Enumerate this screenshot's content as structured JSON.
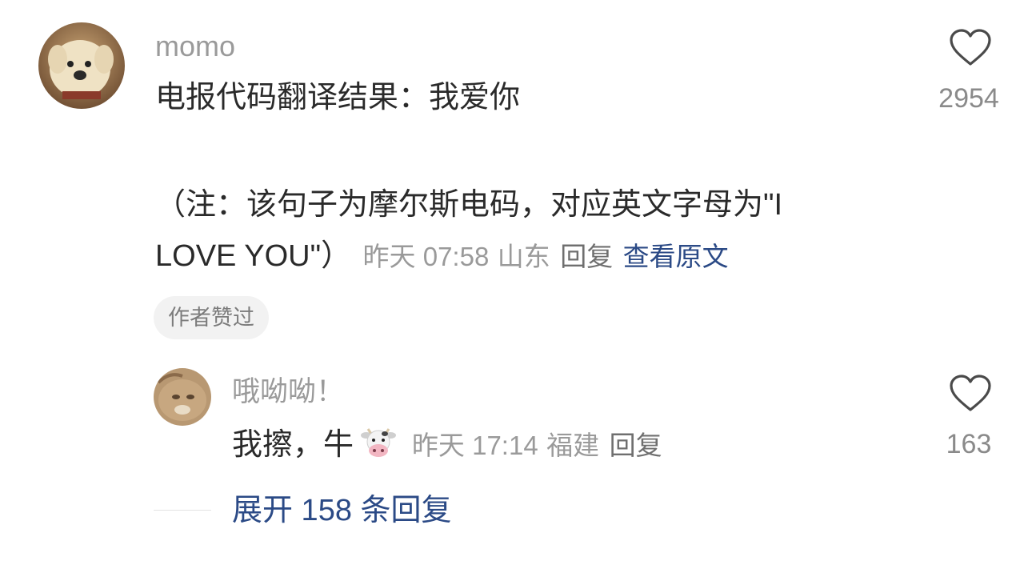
{
  "main_comment": {
    "username": "momo",
    "line1": "电报代码翻译结果：我爱你",
    "line3": "（注：该句子为摩尔斯电码，对应英文字母为\"I",
    "line4": "LOVE YOU\"）",
    "time": "昨天 07:58",
    "location": "山东",
    "reply_label": "回复",
    "view_original_label": "查看原文",
    "badge": "作者赞过",
    "like_count": "2954"
  },
  "reply_comment": {
    "username": "哦呦呦！",
    "text": "我擦，牛",
    "emoji": "cow-face-emoji",
    "time": "昨天 17:14",
    "location": "福建",
    "reply_label": "回复",
    "like_count": "163"
  },
  "expand_replies": {
    "label": "展开 158 条回复"
  },
  "icons": {
    "like": "heart-outline-icon"
  }
}
